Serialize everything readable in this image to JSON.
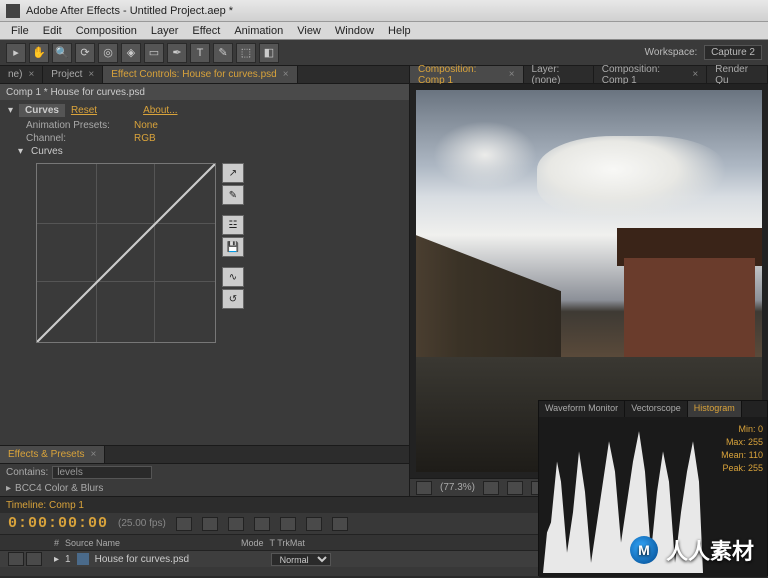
{
  "titlebar": {
    "title": "Adobe After Effects - Untitled Project.aep *"
  },
  "menu": {
    "items": [
      "File",
      "Edit",
      "Composition",
      "Layer",
      "Effect",
      "Animation",
      "View",
      "Window",
      "Help"
    ]
  },
  "toolbar": {
    "workspace_label": "Workspace:",
    "workspace_value": "Capture 2"
  },
  "leftTabs": {
    "t0": "ne)",
    "t1": "Project",
    "t2": "Effect Controls: House for curves.psd"
  },
  "panelHeader": "Comp 1 * House for curves.psd",
  "fx": {
    "name": "Curves",
    "reset": "Reset",
    "about": "About...",
    "presets_label": "Animation Presets:",
    "presets_value": "None",
    "channel_label": "Channel:",
    "channel_value": "RGB",
    "curves_label": "Curves"
  },
  "effectsPresets": {
    "title": "Effects & Presets",
    "contains_label": "Contains:",
    "contains_value": "levels",
    "folder": "BCC4 Color & Blurs"
  },
  "compTabs": {
    "t0": "Composition: Comp 1",
    "t1": "Layer: (none)",
    "t2": "Composition: Comp 1",
    "t3": "Render Qu"
  },
  "viewerStatus": {
    "zoom": "(77.3%)"
  },
  "timeline": {
    "tab": "Timeline: Comp 1",
    "timecode": "0:00:00:00",
    "fps": "(25.00 fps)",
    "col_num": "#",
    "col_source": "Source Name",
    "col_mode": "Mode",
    "col_trk": "T  TrkMat",
    "layer_num": "1",
    "layer_name": "House for curves.psd",
    "layer_mode": "Normal"
  },
  "scope": {
    "tabs": {
      "t0": "Waveform Monitor",
      "t1": "Vectorscope",
      "t2": "Histogram"
    },
    "stats": {
      "min_l": "Min:",
      "min_v": "0",
      "max_l": "Max:",
      "max_v": "255",
      "mean_l": "Mean:",
      "mean_v": "110",
      "peak_l": "Peak:",
      "peak_v": "255"
    }
  },
  "watermark": "人人素材",
  "chart_data": {
    "type": "line",
    "title": "Curves (identity)",
    "x": [
      0,
      255
    ],
    "y": [
      0,
      255
    ],
    "xlim": [
      0,
      255
    ],
    "ylim": [
      0,
      255
    ],
    "channel": "RGB"
  }
}
